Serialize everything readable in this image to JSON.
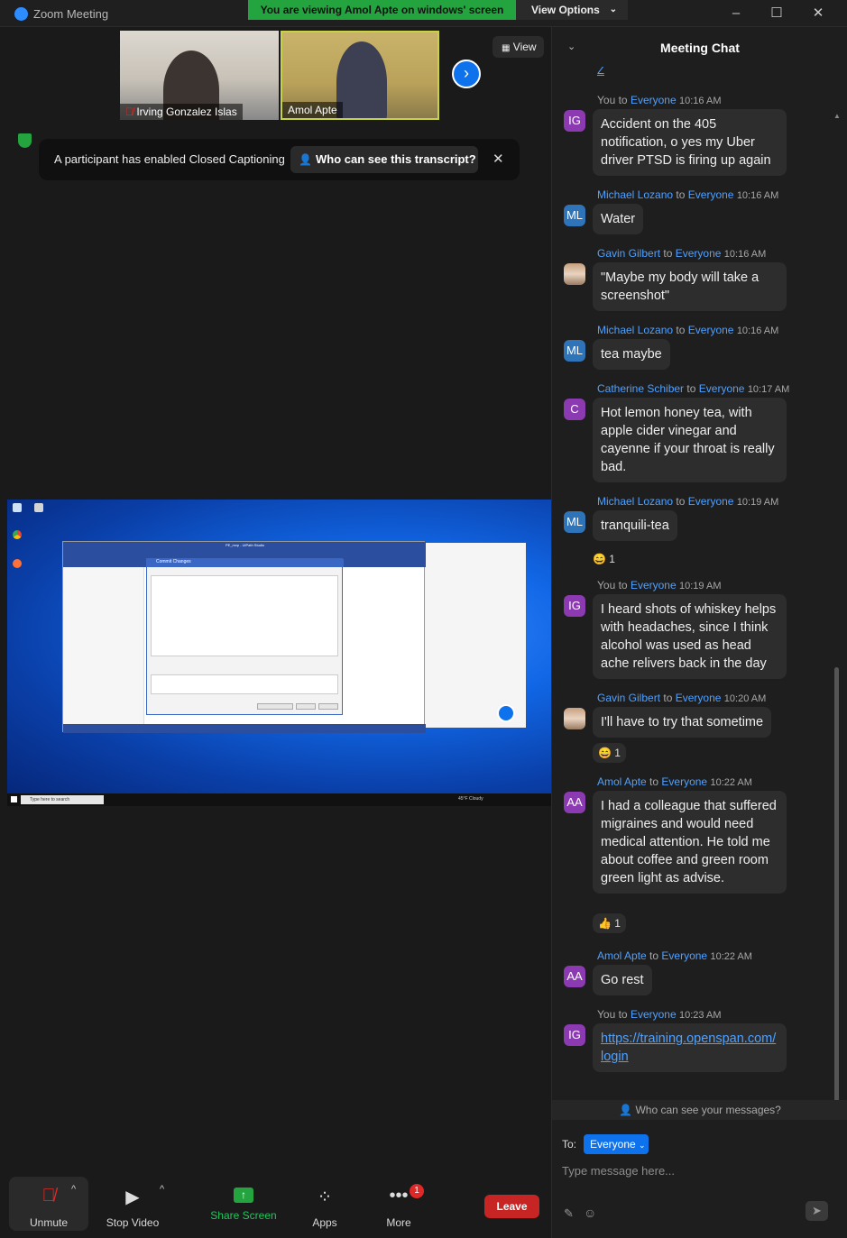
{
  "window": {
    "title": "Zoom Meeting",
    "viewing_banner": "You are viewing Amol Apte on windows' screen",
    "view_options": "View Options"
  },
  "gallery": {
    "participants": [
      {
        "name": "Irving Gonzalez Islas",
        "muted": true
      },
      {
        "name": "Amol Apte",
        "muted": false
      }
    ],
    "view_label": "View"
  },
  "captions": {
    "notice": "A participant has enabled Closed Captioning",
    "who_can_see": "Who can see this transcript?"
  },
  "toolbar": {
    "unmute": "Unmute",
    "stop_video": "Stop Video",
    "share_screen": "Share Screen",
    "apps": "Apps",
    "more": "More",
    "more_badge": "1",
    "leave": "Leave"
  },
  "chat": {
    "title": "Meeting Chat",
    "partial_top": "Z",
    "messages": [
      {
        "sender": "You",
        "to": "Everyone",
        "time": "10:16 AM",
        "initials": "IG",
        "avatar": "av-ig",
        "text": "Accident on the 405 notification, o yes my Uber driver PTSD is firing up again"
      },
      {
        "sender": "Michael Lozano",
        "to": "Everyone",
        "time": "10:16 AM",
        "initials": "ML",
        "avatar": "av-ml",
        "text": "Water"
      },
      {
        "sender": "Gavin Gilbert",
        "to": "Everyone",
        "time": "10:16 AM",
        "initials": "",
        "avatar": "av-photo",
        "text": "\"Maybe my body will take a screenshot\""
      },
      {
        "sender": "Michael Lozano",
        "to": "Everyone",
        "time": "10:16 AM",
        "initials": "ML",
        "avatar": "av-ml",
        "text": "tea maybe"
      },
      {
        "sender": "Catherine Schiber",
        "to": "Everyone",
        "time": "10:17 AM",
        "initials": "C",
        "avatar": "av-c",
        "text": "Hot lemon honey tea, with apple cider vinegar and cayenne if your throat is really bad."
      },
      {
        "sender": "Michael Lozano",
        "to": "Everyone",
        "time": "10:19 AM",
        "initials": "ML",
        "avatar": "av-ml",
        "text": "tranquili-tea",
        "reaction": "😄",
        "reaction_count": "1"
      },
      {
        "sender": "You",
        "to": "Everyone",
        "time": "10:19 AM",
        "initials": "IG",
        "avatar": "av-ig",
        "text": "I heard shots of whiskey helps with headaches, since I think alcohol was used as head ache relivers back in the day"
      },
      {
        "sender": "Gavin Gilbert",
        "to": "Everyone",
        "time": "10:20 AM",
        "initials": "",
        "avatar": "av-photo",
        "text": "I'll have to try that sometime",
        "reaction": "😄",
        "reaction_count": "1"
      },
      {
        "sender": "Amol Apte",
        "to": "Everyone",
        "time": "10:22 AM",
        "initials": "AA",
        "avatar": "av-aa",
        "text": "I had a colleague that suffered migraines and would need medical attention. He told me about coffee and green room green light as advise.",
        "reaction": "👍",
        "reaction_count": "1"
      },
      {
        "sender": "Amol Apte",
        "to": "Everyone",
        "time": "10:22 AM",
        "initials": "AA",
        "avatar": "av-aa",
        "text": "Go rest"
      },
      {
        "sender": "You",
        "to": "Everyone",
        "time": "10:23 AM",
        "initials": "IG",
        "avatar": "av-ig",
        "text": "https://training.openspan.com/login",
        "is_link": true
      }
    ],
    "connector": "to",
    "who_can_see": "Who can see your messages?",
    "to_label": "To:",
    "recipient": "Everyone",
    "input_placeholder": "Type message here..."
  },
  "shared_screen": {
    "app_title": "PE_mvp - UiPath Studio",
    "dialog_title": "Commit Changes",
    "taskbar_search": "Type here to search",
    "weather": "45°F Cloudy"
  }
}
